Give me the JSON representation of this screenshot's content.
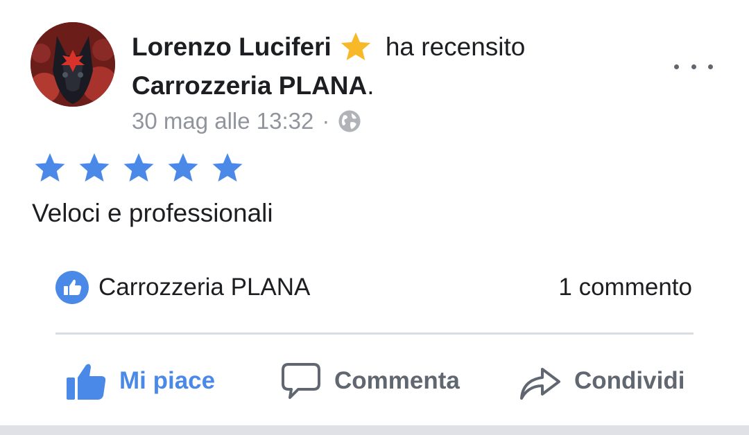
{
  "post": {
    "author": "Lorenzo Luciferi",
    "action_text": "ha recensito",
    "page_name": "Carrozzeria PLANA",
    "period": ".",
    "timestamp": "30 mag alle 13:32",
    "separator": "·",
    "privacy_icon": "globe-icon",
    "badge_icon": "star-icon",
    "more_icon": "more-dots-icon"
  },
  "review": {
    "rating": 5,
    "rating_max": 5,
    "text": "Veloci e professionali"
  },
  "engagement": {
    "liked_by": "Carrozzeria PLANA",
    "comments": "1 commento"
  },
  "actions": {
    "like_label": "Mi piace",
    "comment_label": "Commenta",
    "share_label": "Condividi"
  },
  "colors": {
    "accent": "#4a89e8",
    "star_badge": "#f7b928",
    "muted_text": "#90949c",
    "action_text": "#606770"
  }
}
